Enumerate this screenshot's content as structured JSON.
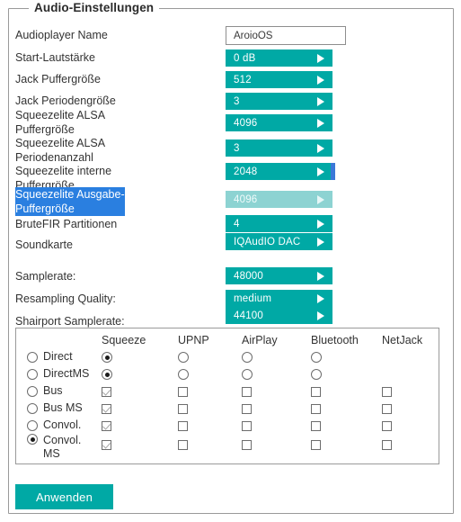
{
  "panel": {
    "legend": "Audio-Einstellungen"
  },
  "text_field": {
    "label": "Audioplayer Name",
    "value": "AroioOS",
    "placeholder": "AroioOS"
  },
  "settings": [
    {
      "label": "Start-Lautstärke",
      "value": "0 dB",
      "selected": false
    },
    {
      "label": "Jack Puffergröße",
      "value": "512",
      "selected": false
    },
    {
      "label": "Jack Periodengröße",
      "value": "3",
      "selected": false
    },
    {
      "label": "Squeezelite ALSA\nPuffergröße",
      "value": "4096",
      "selected": false
    },
    {
      "label": "Squeezelite ALSA\nPeriodenanzahl",
      "value": "3",
      "selected": false
    },
    {
      "label": "Squeezelite interne\nPuffergröße",
      "value": "2048",
      "selected": false
    },
    {
      "label": "Squeezelite Ausgabe-\nPuffergröße",
      "value": "4096",
      "selected": true
    },
    {
      "label": "BruteFIR Partitionen",
      "value": "4",
      "selected": false
    },
    {
      "label": "Soundkarte",
      "value": "IQAudIO DAC",
      "selected": false
    }
  ],
  "samplerates": [
    {
      "label": "Samplerate:",
      "value": "48000"
    },
    {
      "label": "Resampling Quality:",
      "value": "medium"
    },
    {
      "label": "Shairport Samplerate:",
      "value": "44100"
    }
  ],
  "matrix": {
    "columns": [
      "Squeeze",
      "UPNP",
      "AirPlay",
      "Bluetooth",
      "NetJack"
    ],
    "rows": [
      {
        "label": "Direct",
        "mode_selected": false,
        "cells": [
          "radio-on",
          "radio-off",
          "radio-off",
          "radio-off",
          "none"
        ]
      },
      {
        "label": "DirectMS",
        "mode_selected": false,
        "cells": [
          "radio-on",
          "radio-off",
          "radio-off",
          "radio-off",
          "none"
        ]
      },
      {
        "label": "Bus",
        "mode_selected": false,
        "cells": [
          "check-on",
          "check-off",
          "check-off",
          "check-off",
          "check-off"
        ]
      },
      {
        "label": "Bus MS",
        "mode_selected": false,
        "cells": [
          "check-on",
          "check-off",
          "check-off",
          "check-off",
          "check-off"
        ]
      },
      {
        "label": "Convol.",
        "mode_selected": false,
        "cells": [
          "check-on",
          "check-off",
          "check-off",
          "check-off",
          "check-off"
        ]
      },
      {
        "label": "Convol.\nMS",
        "mode_selected": true,
        "cells": [
          "check-on",
          "check-off",
          "check-off",
          "check-off",
          "check-off"
        ]
      }
    ]
  },
  "apply_button": {
    "label": "Anwenden"
  },
  "colors": {
    "teal": "#00a9a5",
    "teal_faded": "#8dd3d2",
    "selection_blue": "#2a7fe0",
    "border_gray": "#9a9a9a",
    "text": "#333333"
  }
}
